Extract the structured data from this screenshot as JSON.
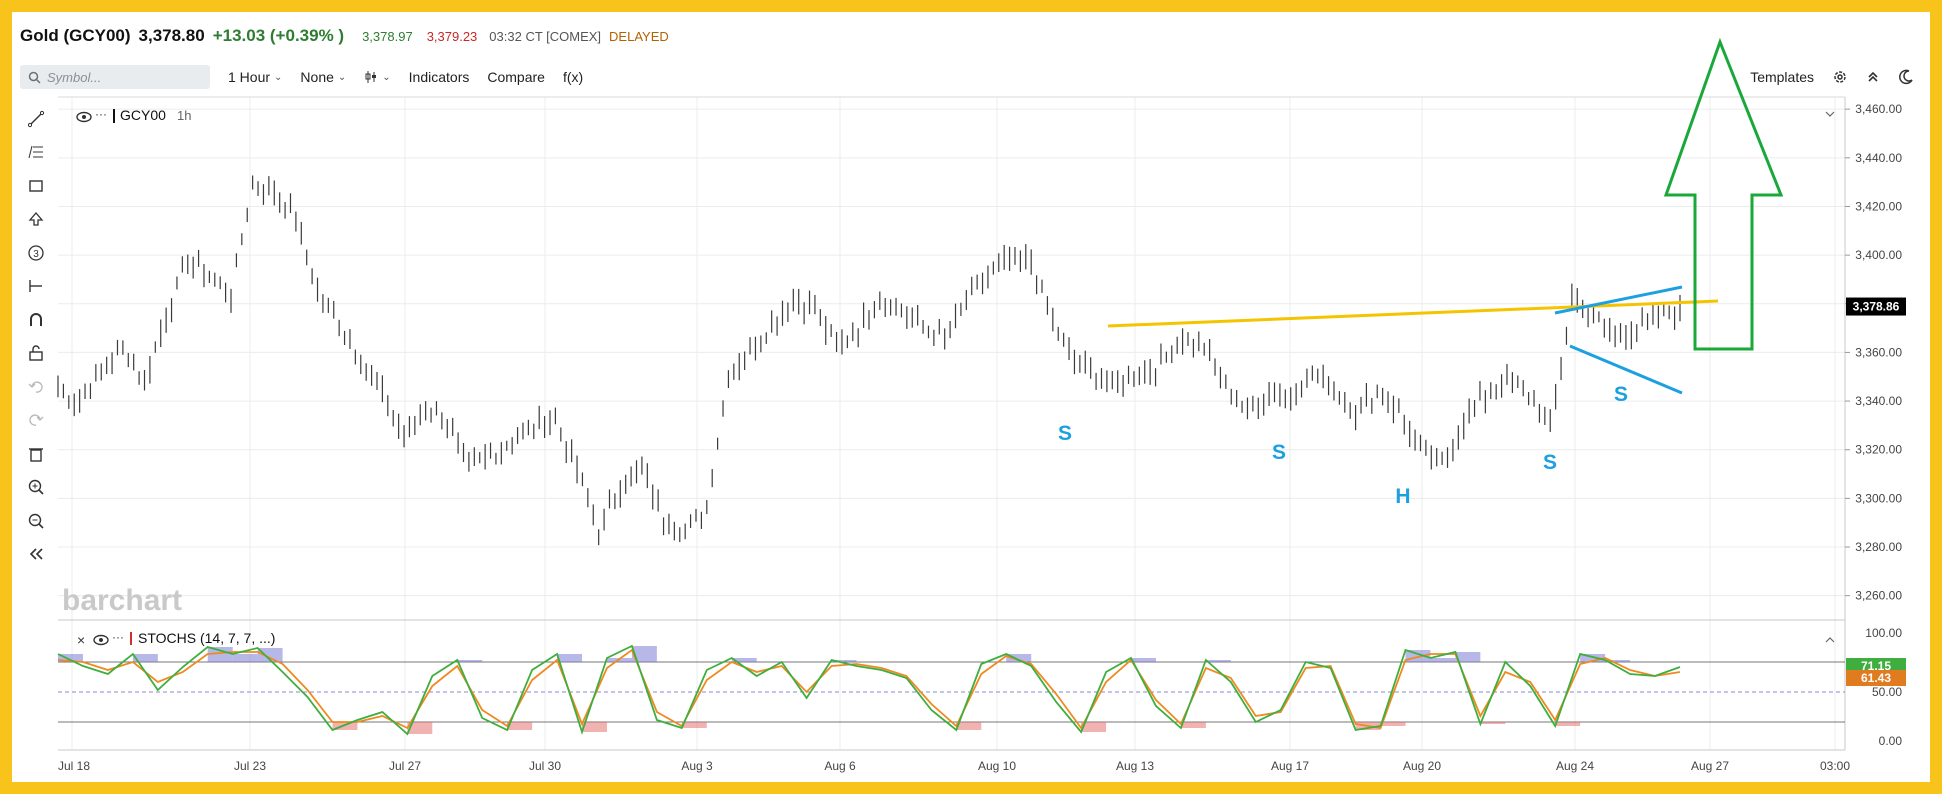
{
  "header": {
    "name": "Gold (GCY00)",
    "last": "3,378.80",
    "change": "+13.03 (+0.39% )",
    "bid": "3,378.97",
    "ask": "3,379.23",
    "time": "03:32 CT [COMEX]",
    "status": "DELAYED"
  },
  "toolbar": {
    "search_placeholder": "Symbol...",
    "interval": "1 Hour",
    "none_label": "None",
    "indicators": "Indicators",
    "compare": "Compare",
    "fx": "f(x)",
    "templates": "Templates"
  },
  "legend": {
    "symbol": "GCY00",
    "interval": "1h",
    "stoch": "STOCHS (14, 7, 7, ...)"
  },
  "watermark": "barchart",
  "icons": [
    "line-draw-icon",
    "fib-icon",
    "rectangle-icon",
    "arrow-icon",
    "number-icon",
    "measure-icon",
    "magnet-icon",
    "lock-icon",
    "undo-icon",
    "redo-icon",
    "trash-icon",
    "zoom-in-icon",
    "zoom-out-icon",
    "collapse-icon"
  ],
  "colors": {
    "up": "#2e7d32",
    "down": "#c62828",
    "price_tag": "#000000",
    "trendline": "#f5c400",
    "wedge": "#1ca0e0",
    "arrow": "#1aa83a",
    "k_line": "#3fae3f",
    "d_line": "#ee8a20",
    "stoch_tag": "#e07b20"
  },
  "chart_data": [
    {
      "type": "line",
      "title": "GCY00",
      "y_ticks": [
        "3,460.00",
        "3,440.00",
        "3,420.00",
        "3,400.00",
        "3,380.00",
        "3,360.00",
        "3,340.00",
        "3,320.00",
        "3,300.00",
        "3,280.00",
        "3,260.00"
      ],
      "ylim": [
        3250,
        3465
      ],
      "x_labels": [
        "Jul 18",
        "Jul 23",
        "Jul 27",
        "Jul 30",
        "Aug 3",
        "Aug 6",
        "Aug 10",
        "Aug 13",
        "Aug 17",
        "Aug 20",
        "Aug 24",
        "Aug 27",
        "03:00"
      ],
      "current_price_label": "3,378.86",
      "current_price": 3378.86,
      "series": [
        {
          "values": [
            3345,
            3340,
            3352,
            3362,
            3348,
            3375,
            3398,
            3392,
            3384,
            3430,
            3426,
            3415,
            3385,
            3372,
            3358,
            3342,
            3325,
            3338,
            3332,
            3312,
            3318,
            3324,
            3330,
            3332,
            3312,
            3286,
            3305,
            3312,
            3292,
            3286,
            3296,
            3352,
            3360,
            3372,
            3382,
            3378,
            3362,
            3370,
            3382,
            3378,
            3370,
            3366,
            3380,
            3392,
            3398,
            3398,
            3372,
            3356,
            3350,
            3346,
            3352,
            3355,
            3366,
            3362,
            3346,
            3336,
            3344,
            3342,
            3352,
            3345,
            3336,
            3344,
            3336,
            3320,
            3314,
            3332,
            3342,
            3350,
            3343,
            3328,
            3382,
            3375,
            3367,
            3370,
            3374,
            3378
          ]
        }
      ],
      "annotations": [
        "S",
        "S",
        "H",
        "S",
        "S"
      ]
    },
    {
      "type": "line",
      "title": "STOCHS (14, 7, 7, ...)",
      "y_ticks": [
        "100.00",
        "50.00",
        "0.00"
      ],
      "ylim": [
        0,
        100
      ],
      "reference_levels": [
        80,
        50,
        20
      ],
      "k_value_label": "71.15",
      "d_value_label": "61.43",
      "series": [
        {
          "name": "%K",
          "values": [
            88,
            76,
            68,
            88,
            52,
            75,
            95,
            88,
            94,
            70,
            45,
            12,
            22,
            30,
            8,
            66,
            82,
            24,
            12,
            72,
            88,
            10,
            84,
            96,
            22,
            14,
            72,
            84,
            66,
            80,
            44,
            82,
            76,
            72,
            64,
            32,
            12,
            78,
            88,
            76,
            40,
            10,
            70,
            84,
            36,
            14,
            82,
            60,
            20,
            32,
            80,
            74,
            12,
            16,
            92,
            84,
            90,
            18,
            80,
            56,
            16,
            88,
            82,
            68,
            66,
            75
          ]
        },
        {
          "name": "%D",
          "values": [
            82,
            80,
            72,
            80,
            60,
            70,
            88,
            90,
            90,
            78,
            52,
            20,
            20,
            26,
            14,
            56,
            76,
            32,
            16,
            62,
            82,
            18,
            74,
            92,
            30,
            16,
            62,
            80,
            70,
            76,
            50,
            76,
            78,
            74,
            66,
            38,
            16,
            68,
            86,
            78,
            48,
            14,
            60,
            82,
            42,
            18,
            74,
            64,
            26,
            30,
            74,
            76,
            18,
            14,
            82,
            88,
            88,
            26,
            70,
            60,
            22,
            78,
            84,
            72,
            66,
            70
          ]
        }
      ]
    }
  ]
}
